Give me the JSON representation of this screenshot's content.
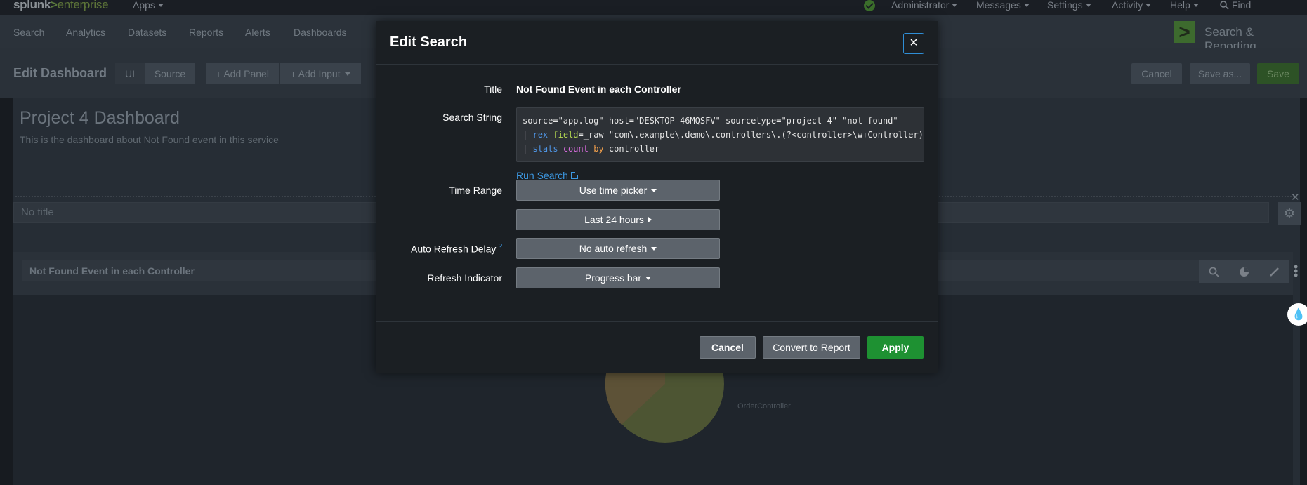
{
  "topbar": {
    "logo_main": "splunk",
    "logo_gt": ">",
    "logo_suffix": "enterprise",
    "apps": "Apps",
    "administrator": "Administrator",
    "messages": "Messages",
    "settings": "Settings",
    "activity": "Activity",
    "help": "Help",
    "find": "Find"
  },
  "nav": {
    "items": [
      "Search",
      "Analytics",
      "Datasets",
      "Reports",
      "Alerts",
      "Dashboards"
    ],
    "app_logo": ">",
    "app_name": "Search & Reporting"
  },
  "editbar": {
    "title": "Edit Dashboard",
    "ui_tab": "UI",
    "source_tab": "Source",
    "add_panel": "+ Add Panel",
    "add_input": "+ Add Input",
    "cancel": "Cancel",
    "save_as": "Save as...",
    "save": "Save"
  },
  "dashboard": {
    "title": "Project 4 Dashboard",
    "description": "This is the dashboard about Not Found event in this service",
    "row_title_placeholder": "No title",
    "panel_title": "Not Found Event in each Controller",
    "pie_label": "OrderController"
  },
  "modal": {
    "title": "Edit Search",
    "close": "×",
    "labels": {
      "title": "Title",
      "search_string": "Search String",
      "time_range": "Time Range",
      "auto_refresh": "Auto Refresh Delay",
      "auto_refresh_help": "?",
      "refresh_indicator": "Refresh Indicator"
    },
    "title_value": "Not Found Event in each Controller",
    "search": {
      "line1": "source=\"app.log\" host=\"DESKTOP-46MQSFV\" sourcetype=\"project 4\" \"not found\"",
      "pipe": "|",
      "rex_cmd": "rex",
      "rex_arg": "field",
      "rex_rest": "=_raw \"com\\.example\\.demo\\.controllers\\.(?<controller>\\w+Controller)\"",
      "stats_cmd": "stats",
      "stats_fn": "count",
      "stats_kw": "by",
      "stats_field": "controller"
    },
    "run_search": "Run Search",
    "time_picker": "Use time picker",
    "last_24": "Last 24 hours",
    "auto_refresh_value": "No auto refresh",
    "refresh_indicator_value": "Progress bar",
    "buttons": {
      "cancel": "Cancel",
      "convert": "Convert to Report",
      "apply": "Apply"
    }
  },
  "colors": {
    "accent_blue": "#3c97e0",
    "apply_green": "#1e9132",
    "modal_bg": "#1b1f23"
  }
}
